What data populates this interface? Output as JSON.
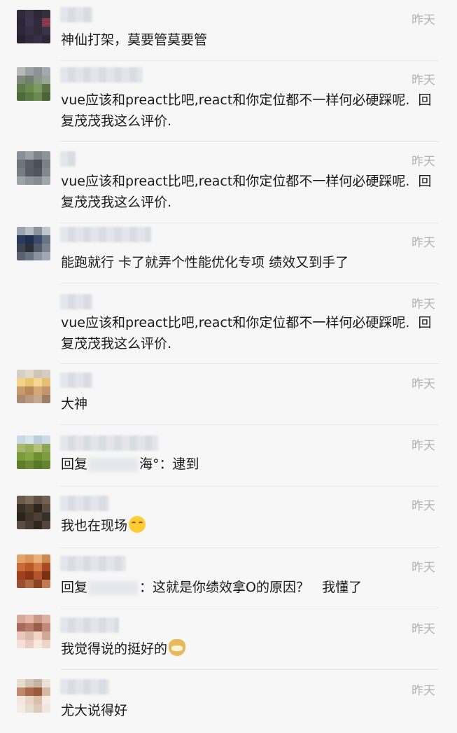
{
  "comments": [
    {
      "time": "昨天",
      "text": "神仙打架，莫要管莫要管",
      "avatar": [
        "#2e2a3a",
        "#3a3448",
        "#2c2838",
        "#332e40",
        "#2a2636",
        "#3b3550",
        "#2f2a3c",
        "#8b3a4a",
        "#2c2838",
        "#342f44",
        "#2e2a3a",
        "#3a3448",
        "#262232",
        "#2f2a3c",
        "#353046",
        "#2c2838"
      ]
    },
    {
      "time": "昨天",
      "text": "vue应该和preact比吧,react和你定位都不一样何必硬踩呢.  回复茂茂我这么评价.",
      "avatar": [
        "#b8b8b8",
        "#9aa0a4",
        "#8c9398",
        "#a5a9ad",
        "#7d8a7a",
        "#6f7f6c",
        "#8a9688",
        "#9aa598",
        "#5f7a4a",
        "#6a8a50",
        "#7a9a60",
        "#5c7444",
        "#4e6a3a",
        "#5a7a44",
        "#6a8a52",
        "#4a6438"
      ]
    },
    {
      "time": "昨天",
      "text": "vue应该和preact比吧,react和你定位都不一样何必硬踩呢.  回复茂茂我这么评价.",
      "avatar": [
        "#8a8f96",
        "#9aa0a8",
        "#7e848c",
        "#8d939a",
        "#6e747c",
        "#5a5f66",
        "#4c5056",
        "#7a8088",
        "#767c84",
        "#585d64",
        "#50555c",
        "#828890",
        "#9ca2aa",
        "#8e949c",
        "#868c94",
        "#a0a6ae"
      ]
    },
    {
      "time": "昨天",
      "text": "能跑就行 卡了就弄个性能优化专项 绩效又到手了",
      "avatar": [
        "#9aa2ae",
        "#b6bcc6",
        "#8a929e",
        "#c0c6ce",
        "#2a3a5a",
        "#1e2e4e",
        "#3a4a6a",
        "#6a7484",
        "#3c4454",
        "#2a2f38",
        "#50586a",
        "#7a8290",
        "#5a6270",
        "#6a7280",
        "#8a929e",
        "#a0a8b4"
      ]
    },
    {
      "time": "昨天",
      "text": "vue应该和preact比吧,react和你定位都不一样何必硬踩呢.  回复茂茂我这么评价.",
      "avatar": []
    },
    {
      "time": "昨天",
      "text": "大神",
      "avatar": [
        "#d8cfc4",
        "#e2d8cc",
        "#cfc4b6",
        "#d6ccbf",
        "#f0d48a",
        "#e8c46a",
        "#f2d894",
        "#e6bf70",
        "#c89a6a",
        "#b8865a",
        "#d6a878",
        "#c4946a",
        "#a88a70",
        "#b89a80",
        "#c6a88e",
        "#9c8066"
      ]
    },
    {
      "time": "昨天",
      "text": "回复{blur}海°：逮到",
      "avatar": [
        "#c8d8e4",
        "#d6e4ec",
        "#bccedc",
        "#cadae6",
        "#a8b870",
        "#9aae5c",
        "#b4c27c",
        "#8ea452",
        "#7a9a3c",
        "#86a646",
        "#6e8e34",
        "#7c9c40",
        "#5e7e2c",
        "#6a8a36",
        "#587828",
        "#648432"
      ]
    },
    {
      "time": "昨天",
      "text": "我也在现场{laugh}",
      "avatar": [
        "#6a5a4a",
        "#7a6a58",
        "#5e5042",
        "#706050",
        "#3a3028",
        "#4a3e32",
        "#2e261e",
        "#5a4c3e",
        "#2a241e",
        "#3e342a",
        "#4c4034",
        "#36302a",
        "#5a4e42",
        "#463c32",
        "#30281f",
        "#524638"
      ]
    },
    {
      "time": "昨天",
      "text": "回复{blur}：这就是你绩效拿O的原因？   我懂了",
      "avatar": [
        "#e0a46a",
        "#d8945a",
        "#e8b07a",
        "#cc884e",
        "#c86a3a",
        "#b8582a",
        "#d47a46",
        "#a84a22",
        "#a0401c",
        "#8c3616",
        "#b4562c",
        "#7a2e12",
        "#9a5030",
        "#b06a40",
        "#8a4424",
        "#c07c50"
      ]
    },
    {
      "time": "昨天",
      "text": "我觉得说的挺好的{doge}",
      "avatar": [
        "#d8a898",
        "#e4b8a8",
        "#cc9888",
        "#dcb0a0",
        "#a86a5a",
        "#b87a6a",
        "#9a5c4c",
        "#c08a7a",
        "#e8c8bc",
        "#dcb8ac",
        "#f0d4c8",
        "#d0a898",
        "#f4e0d8",
        "#e8ccc0",
        "#f8e8e0",
        "#ecd4c8"
      ]
    },
    {
      "time": "昨天",
      "text": "尤大说得好",
      "avatar": [
        "#e8dcd0",
        "#d4c4b4",
        "#c6b4a2",
        "#ece2d8",
        "#c08a6a",
        "#a86a4a",
        "#9a5a3c",
        "#d8b8a0",
        "#f2e8e0",
        "#e8d4c4",
        "#d8c0ac",
        "#f6ece4",
        "#f4ece4",
        "#e8dcd0",
        "#dccabc",
        "#f0e6dc"
      ]
    }
  ]
}
